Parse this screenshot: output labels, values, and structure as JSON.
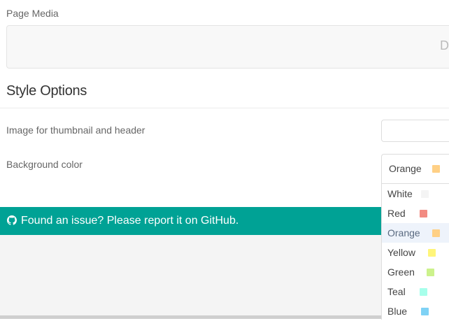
{
  "page_media": {
    "label": "Page Media",
    "dropzone_text": "D"
  },
  "style_options": {
    "title": "Style Options",
    "thumbnail_label": "Image for thumbnail and header",
    "background_label": "Background color",
    "background_selected": "Orange",
    "background_selected_color": "#ffd085"
  },
  "color_options": [
    {
      "label": "White",
      "color": "#f4f4f4"
    },
    {
      "label": "Red",
      "color": "#f28b82"
    },
    {
      "label": "Orange",
      "color": "#ffd085"
    },
    {
      "label": "Yellow",
      "color": "#fff57a"
    },
    {
      "label": "Green",
      "color": "#ccf28c"
    },
    {
      "label": "Teal",
      "color": "#a7ffeb"
    },
    {
      "label": "Blue",
      "color": "#7fd2f5"
    }
  ],
  "banner": {
    "text": "Found an issue? Please report it on GitHub.",
    "icon": "github-icon",
    "color": "#00a295"
  }
}
